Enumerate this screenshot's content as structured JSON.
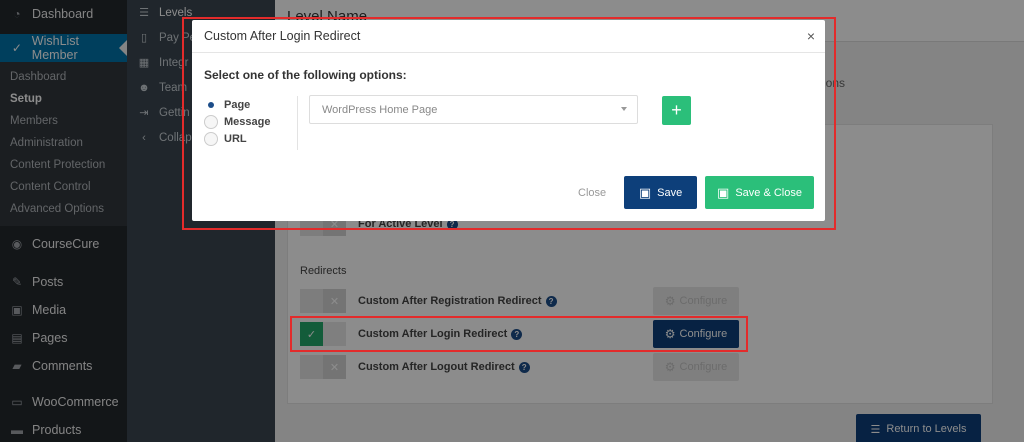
{
  "wp_sidebar": {
    "items_top": [
      {
        "label": "Dashboard",
        "icon": "dashboard-icon",
        "glyph": "◔"
      },
      {
        "label": "WishList Member",
        "icon": "check-icon",
        "glyph": "✓"
      }
    ],
    "submenu": [
      "Dashboard",
      "Setup",
      "Members",
      "Administration",
      "Content Protection",
      "Content Control",
      "Advanced Options"
    ],
    "items_bottom": [
      {
        "label": "CourseCure",
        "icon": "coursecure-icon",
        "glyph": "◉"
      },
      {
        "label": "Posts",
        "icon": "pin-icon",
        "glyph": "✎"
      },
      {
        "label": "Media",
        "icon": "media-icon",
        "glyph": "▣"
      },
      {
        "label": "Pages",
        "icon": "pages-icon",
        "glyph": "▤"
      },
      {
        "label": "Comments",
        "icon": "comments-icon",
        "glyph": "▰"
      },
      {
        "label": "WooCommerce",
        "icon": "woo-icon",
        "glyph": "▭"
      },
      {
        "label": "Products",
        "icon": "products-icon",
        "glyph": "▬"
      }
    ]
  },
  "wlm_nav": {
    "items": [
      {
        "label": "Levels",
        "icon": "list-icon",
        "glyph": "☰"
      },
      {
        "label": "Pay Pe",
        "icon": "document-icon",
        "glyph": "▯"
      },
      {
        "label": "Integr",
        "icon": "calendar-icon",
        "glyph": "▦"
      },
      {
        "label": "Team",
        "icon": "users-icon",
        "glyph": "☻"
      },
      {
        "label": "Gettin",
        "icon": "signin-icon",
        "glyph": "⇥"
      },
      {
        "label": "Collap",
        "icon": "chevron-left-icon",
        "glyph": "‹"
      }
    ]
  },
  "main": {
    "level_name_label": "Level Name",
    "tab_fragment": "ions",
    "section_redirects": "Redirects",
    "for_active_level": "For Active Level",
    "rows": [
      {
        "label": "Custom After Registration Redirect",
        "on": false
      },
      {
        "label": "Custom After Login Redirect",
        "on": true
      },
      {
        "label": "Custom After Logout Redirect",
        "on": false
      }
    ],
    "configure_label": "Configure",
    "return_label": "Return to Levels"
  },
  "modal": {
    "title": "Custom After Login Redirect",
    "close_glyph": "×",
    "prompt": "Select one of the following options:",
    "options": [
      "Page",
      "Message",
      "URL"
    ],
    "selected_option": "Page",
    "select_value": "WordPress Home Page",
    "add_glyph": "+",
    "close_label": "Close",
    "save_label": "Save",
    "save_close_label": "Save & Close"
  },
  "colors": {
    "primary": "#0d3f7a",
    "success": "#2bbf7a",
    "highlight": "#e32b2b",
    "wp_active": "#0073aa"
  }
}
